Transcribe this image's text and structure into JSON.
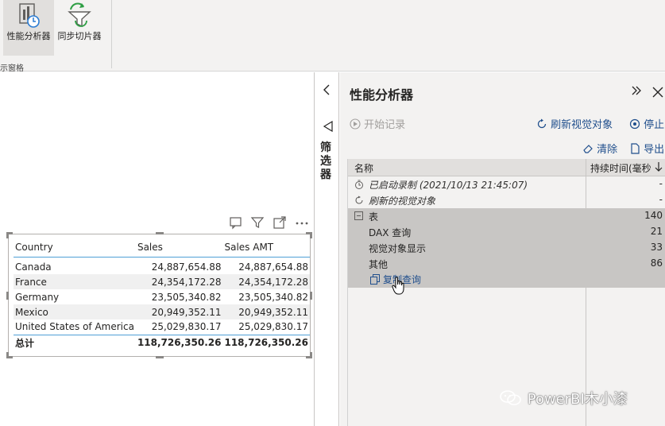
{
  "ribbon": {
    "perf_label": "性能分析器",
    "sync_label": "同步切片器",
    "group_label": "示窗格"
  },
  "matrix": {
    "headers": [
      "Country",
      "Sales",
      "Sales AMT"
    ],
    "rows": [
      {
        "country": "Canada",
        "sales": "24,887,654.88",
        "amt": "24,887,654.88"
      },
      {
        "country": "France",
        "sales": "24,354,172.28",
        "amt": "24,354,172.28"
      },
      {
        "country": "Germany",
        "sales": "23,505,340.82",
        "amt": "23,505,340.82"
      },
      {
        "country": "Mexico",
        "sales": "20,949,352.11",
        "amt": "20,949,352.11"
      },
      {
        "country": "United States of America",
        "sales": "25,029,830.17",
        "amt": "25,029,830.17"
      }
    ],
    "total": {
      "label": "总计",
      "sales": "118,726,350.26",
      "amt": "118,726,350.26"
    }
  },
  "filter_strip": {
    "label": "筛选器"
  },
  "pane": {
    "title": "性能分析器",
    "start_label": "开始记录",
    "refresh_label": "刷新视觉对象",
    "stop_label": "停止",
    "clear_label": "清除",
    "export_label": "导出",
    "col_name": "名称",
    "col_duration": "持续时间(毫秒",
    "rows": [
      {
        "name": "已启动录制 (2021/10/13 21:45:07)",
        "dur": "-"
      },
      {
        "name": "刷新的视觉对象",
        "dur": "-"
      },
      {
        "name": "表",
        "dur": "140"
      },
      {
        "name": "DAX 查询",
        "dur": "21"
      },
      {
        "name": "视觉对象显示",
        "dur": "33"
      },
      {
        "name": "其他",
        "dur": "86"
      }
    ],
    "copy_query": "复制查询"
  },
  "watermark": "PowerBI木小漆",
  "colors": {
    "accent": "#1f4e8c",
    "header_line": "#4f9fd6",
    "pane_bg": "#f3f2f1",
    "selected": "#c8c6c4"
  }
}
